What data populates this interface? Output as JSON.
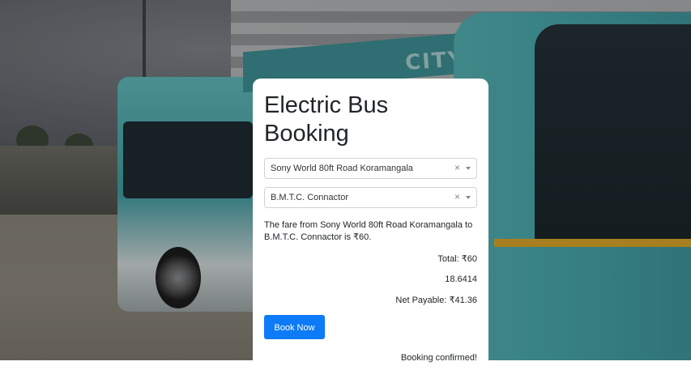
{
  "page": {
    "title": "Electric Bus Booking"
  },
  "background": {
    "banner_text": "CITY BREATHE",
    "accent_color": "#0d7bf5"
  },
  "form": {
    "from": {
      "value": "Sony World 80ft Road Koramangala",
      "clear_symbol": "×"
    },
    "to": {
      "value": "B.M.T.C. Connactor",
      "clear_symbol": "×"
    },
    "fare_message": "The fare from Sony World 80ft Road Koramangala to B.M.T.C. Connactor is ₹60.",
    "total": "Total: ₹60",
    "discount_value": "18.6414",
    "net_payable": "Net Payable: ₹41.36",
    "book_button_label": "Book Now",
    "status": "Booking confirmed!"
  }
}
